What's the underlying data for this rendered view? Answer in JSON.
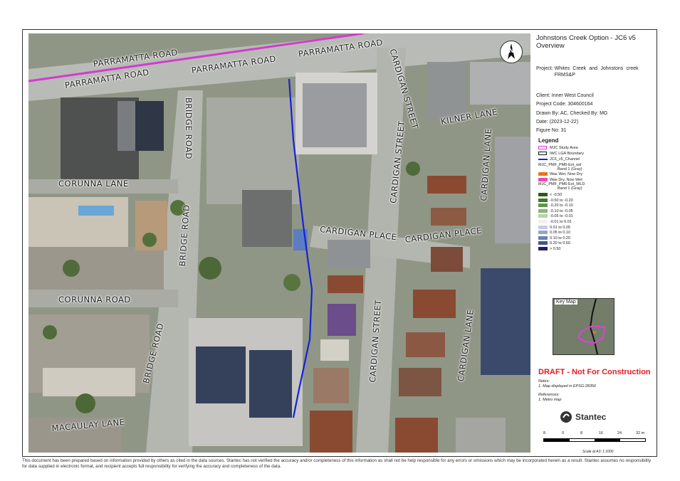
{
  "title": "Johnstons Creek Option - JC6 v5 Overview",
  "project_label": "Project:",
  "project": "Whites Creek and Johnstons creek FRMS&P",
  "client": "Client:  Inner West Council",
  "project_code": "Project Code:  304600164",
  "drawn_by": "Drawn By:  AC, Checked By: MG",
  "date": "Date:  (2023-12-22)",
  "figure_no": "Figure No:  31",
  "north_label": "N",
  "legend": {
    "title": "Legend",
    "study_area": "MJC Study Area",
    "lga": "IWC LGA Boundary",
    "channel": "JC6_v5_Channel",
    "wd_layer": "MJC_PMF_PM6-Ext_wd",
    "wd_band": "Band 1 (Gray)",
    "wd_items": [
      {
        "label": "Was Wet, Now Dry",
        "color": "#e8761a"
      },
      {
        "label": "Was Dry, Now Wet",
        "color": "#e64bb4"
      }
    ],
    "wld_layer": "MJC_PMF_PM6-Ext_WLD",
    "wld_band": "Band 1 (Gray)",
    "wld_items": [
      {
        "label": "< -0.50",
        "color": "#2e5a17"
      },
      {
        "label": "-0.50 to -0.20",
        "color": "#43792a"
      },
      {
        "label": "-0.20 to -0.10",
        "color": "#62954a"
      },
      {
        "label": "-0.10 to -0.05",
        "color": "#8bb577"
      },
      {
        "label": "-0.05 to -0.01",
        "color": "#b9d4ab"
      },
      {
        "label": "-0.01 to 0.01",
        "color": "#f2f2f2"
      },
      {
        "label": "0.01 to 0.05",
        "color": "#c4cde0"
      },
      {
        "label": "0.05 to 0.10",
        "color": "#95a6c9"
      },
      {
        "label": "0.10 to 0.20",
        "color": "#6a80b2"
      },
      {
        "label": "0.20 to 0.50",
        "color": "#3e578f"
      },
      {
        "label": "> 0.50",
        "color": "#251f5c"
      }
    ]
  },
  "keymap_label": "Key Map",
  "draft": "DRAFT - Not For Construction",
  "notes_title": "Notes:",
  "notes_1": "1. Map displayed in EPSG:28356",
  "references_title": "References:",
  "references_1": "1. Metro map",
  "logo": "Stantec",
  "scale": {
    "ticks": [
      "8",
      "0",
      "8",
      "16",
      "24",
      "32 m"
    ],
    "note": "Scale at A3: 1:1000"
  },
  "roads": {
    "parramatta_1": "PARRAMATTA ROAD",
    "parramatta_2": "PARRAMATTA ROAD",
    "parramatta_3": "PARRAMATTA ROAD",
    "parramatta_4": "PARRAMATTA ROAD",
    "bridge_1": "BRIDGE ROAD",
    "bridge_2": "BRIDGE ROAD",
    "bridge_3": "BRIDGE ROAD",
    "corunna_lane": "CORUNNA LANE",
    "corunna_road": "CORUNNA ROAD",
    "macaulay": "MACAULAY LANE",
    "cardigan_st_1": "CARDIGAN STREET",
    "cardigan_st_2": "CARDIGAN STREET",
    "cardigan_st_3": "CARDIGAN STREET",
    "kilner": "KILNER LANE",
    "cardigan_lane_1": "CARDIGAN LANE",
    "cardigan_lane_2": "CARDIGAN LANE",
    "cardigan_place_1": "CARDIGAN PLACE",
    "cardigan_place_2": "CARDIGAN PLACE"
  },
  "disclaimer": "This document has been prepared based on information provided by others as cited in the data sources. Stantec has not verified the accuracy and/or completeness of this information as shall not be help responsible for any errors or omissions which may be incorporated herein as a result. Stantec assumes no responsibility for data supplied in electronic format, and recipient accepts full responsibility for verifying the accuracy and completeness of the data."
}
